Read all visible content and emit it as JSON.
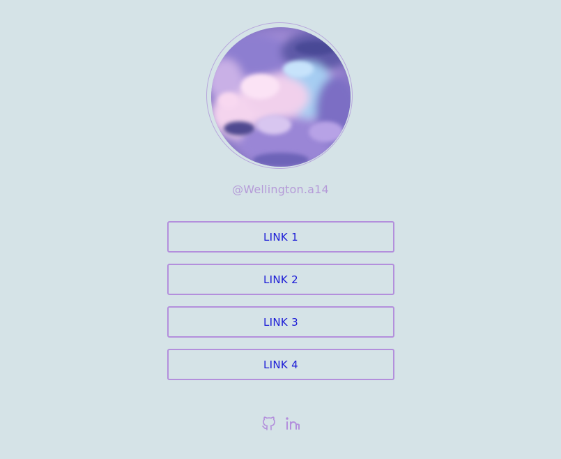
{
  "profile": {
    "username": "@Wellington.a14"
  },
  "links": [
    {
      "label": "LINK 1"
    },
    {
      "label": "LINK 2"
    },
    {
      "label": "LINK 3"
    },
    {
      "label": "LINK 4"
    }
  ],
  "social": [
    {
      "icon": "github-icon"
    },
    {
      "icon": "linkedin-icon"
    }
  ],
  "colors": {
    "background": "#d5e3e7",
    "accent": "#b38fdc",
    "link_text": "#1a1ad6",
    "username": "#b59bd8"
  }
}
